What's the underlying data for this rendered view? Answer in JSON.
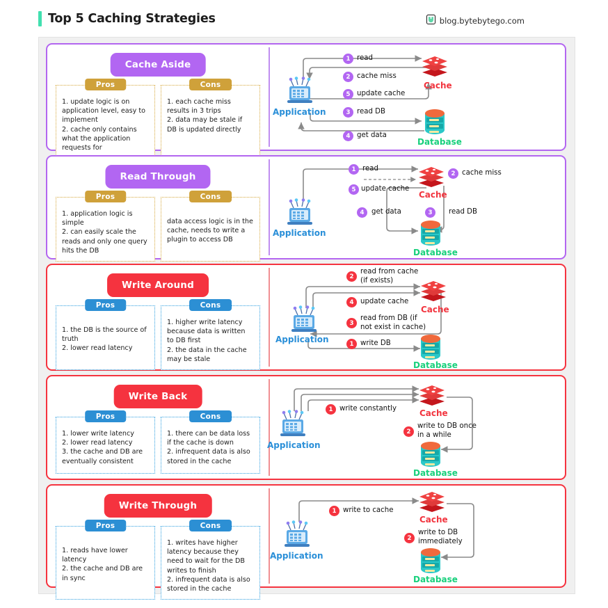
{
  "header": {
    "title": "Top 5 Caching Strategies",
    "brand": "blog.bytebytego.com",
    "brand_icon": "bytebytego-logo-icon",
    "accent_bar_color": "#42e0b0"
  },
  "labels": {
    "pros": "Pros",
    "cons": "Cons",
    "application": "Application",
    "cache": "Cache",
    "database": "Database"
  },
  "colors": {
    "purple": "#b266f2",
    "red": "#f5333f",
    "gold_badge": "#cfa13a",
    "blue_badge": "#2c8fd4",
    "app_blue": "#2a8fd8",
    "cache_red": "#f2353f",
    "db_green": "#18d07c",
    "arrow_gray": "#8a8a8a"
  },
  "sections": [
    {
      "name": "Cache Aside",
      "theme": "purple",
      "pros": "1. update logic is on application level, easy to implement\n2. cache only contains what the application requests for",
      "cons": "1. each cache miss results in 3 trips\n2. data may be stale if DB is updated directly",
      "steps": [
        {
          "n": "1",
          "text": "read"
        },
        {
          "n": "2",
          "text": "cache miss"
        },
        {
          "n": "5",
          "text": "update cache"
        },
        {
          "n": "3",
          "text": "read DB"
        },
        {
          "n": "4",
          "text": "get data"
        }
      ]
    },
    {
      "name": "Read Through",
      "theme": "purple",
      "pros": "1. application logic is simple\n2. can easily scale the reads and only one query hits the DB",
      "cons": "data access logic is in the cache, needs to write a plugin to access DB",
      "steps": [
        {
          "n": "1",
          "text": "read"
        },
        {
          "n": "2",
          "text": "cache miss"
        },
        {
          "n": "5",
          "text": "update cache"
        },
        {
          "n": "4",
          "text": "get data"
        },
        {
          "n": "3",
          "text": "read DB"
        }
      ]
    },
    {
      "name": "Write Around",
      "theme": "red",
      "pros": "1. the DB is the source of truth\n2. lower read latency",
      "cons": "1. higher write latency because data is written to DB first\n2. the data in the cache may be stale",
      "steps": [
        {
          "n": "2",
          "text": "read from cache\n(if exists)"
        },
        {
          "n": "4",
          "text": "update cache"
        },
        {
          "n": "3",
          "text": "read from DB (if\nnot exist in cache)"
        },
        {
          "n": "1",
          "text": "write DB"
        }
      ]
    },
    {
      "name": "Write Back",
      "theme": "red",
      "pros": "1. lower write latency\n2. lower read latency\n3. the cache and DB are eventually consistent",
      "cons": "1. there can be data loss if the cache is down\n2. infrequent data is also stored in the cache",
      "steps": [
        {
          "n": "1",
          "text": "write constantly"
        },
        {
          "n": "2",
          "text": "write to DB ",
          "emphasis": "once\nin a while"
        }
      ]
    },
    {
      "name": "Write Through",
      "theme": "red",
      "pros": "1. reads have lower latency\n2. the cache and DB are in sync",
      "cons": "1. writes have higher latency because they need to wait for the DB writes to finish\n2. infrequent data is also stored in the cache",
      "steps": [
        {
          "n": "1",
          "text": "write to cache"
        },
        {
          "n": "2",
          "text": "write to DB ",
          "emphasis": "immediately"
        }
      ]
    }
  ]
}
